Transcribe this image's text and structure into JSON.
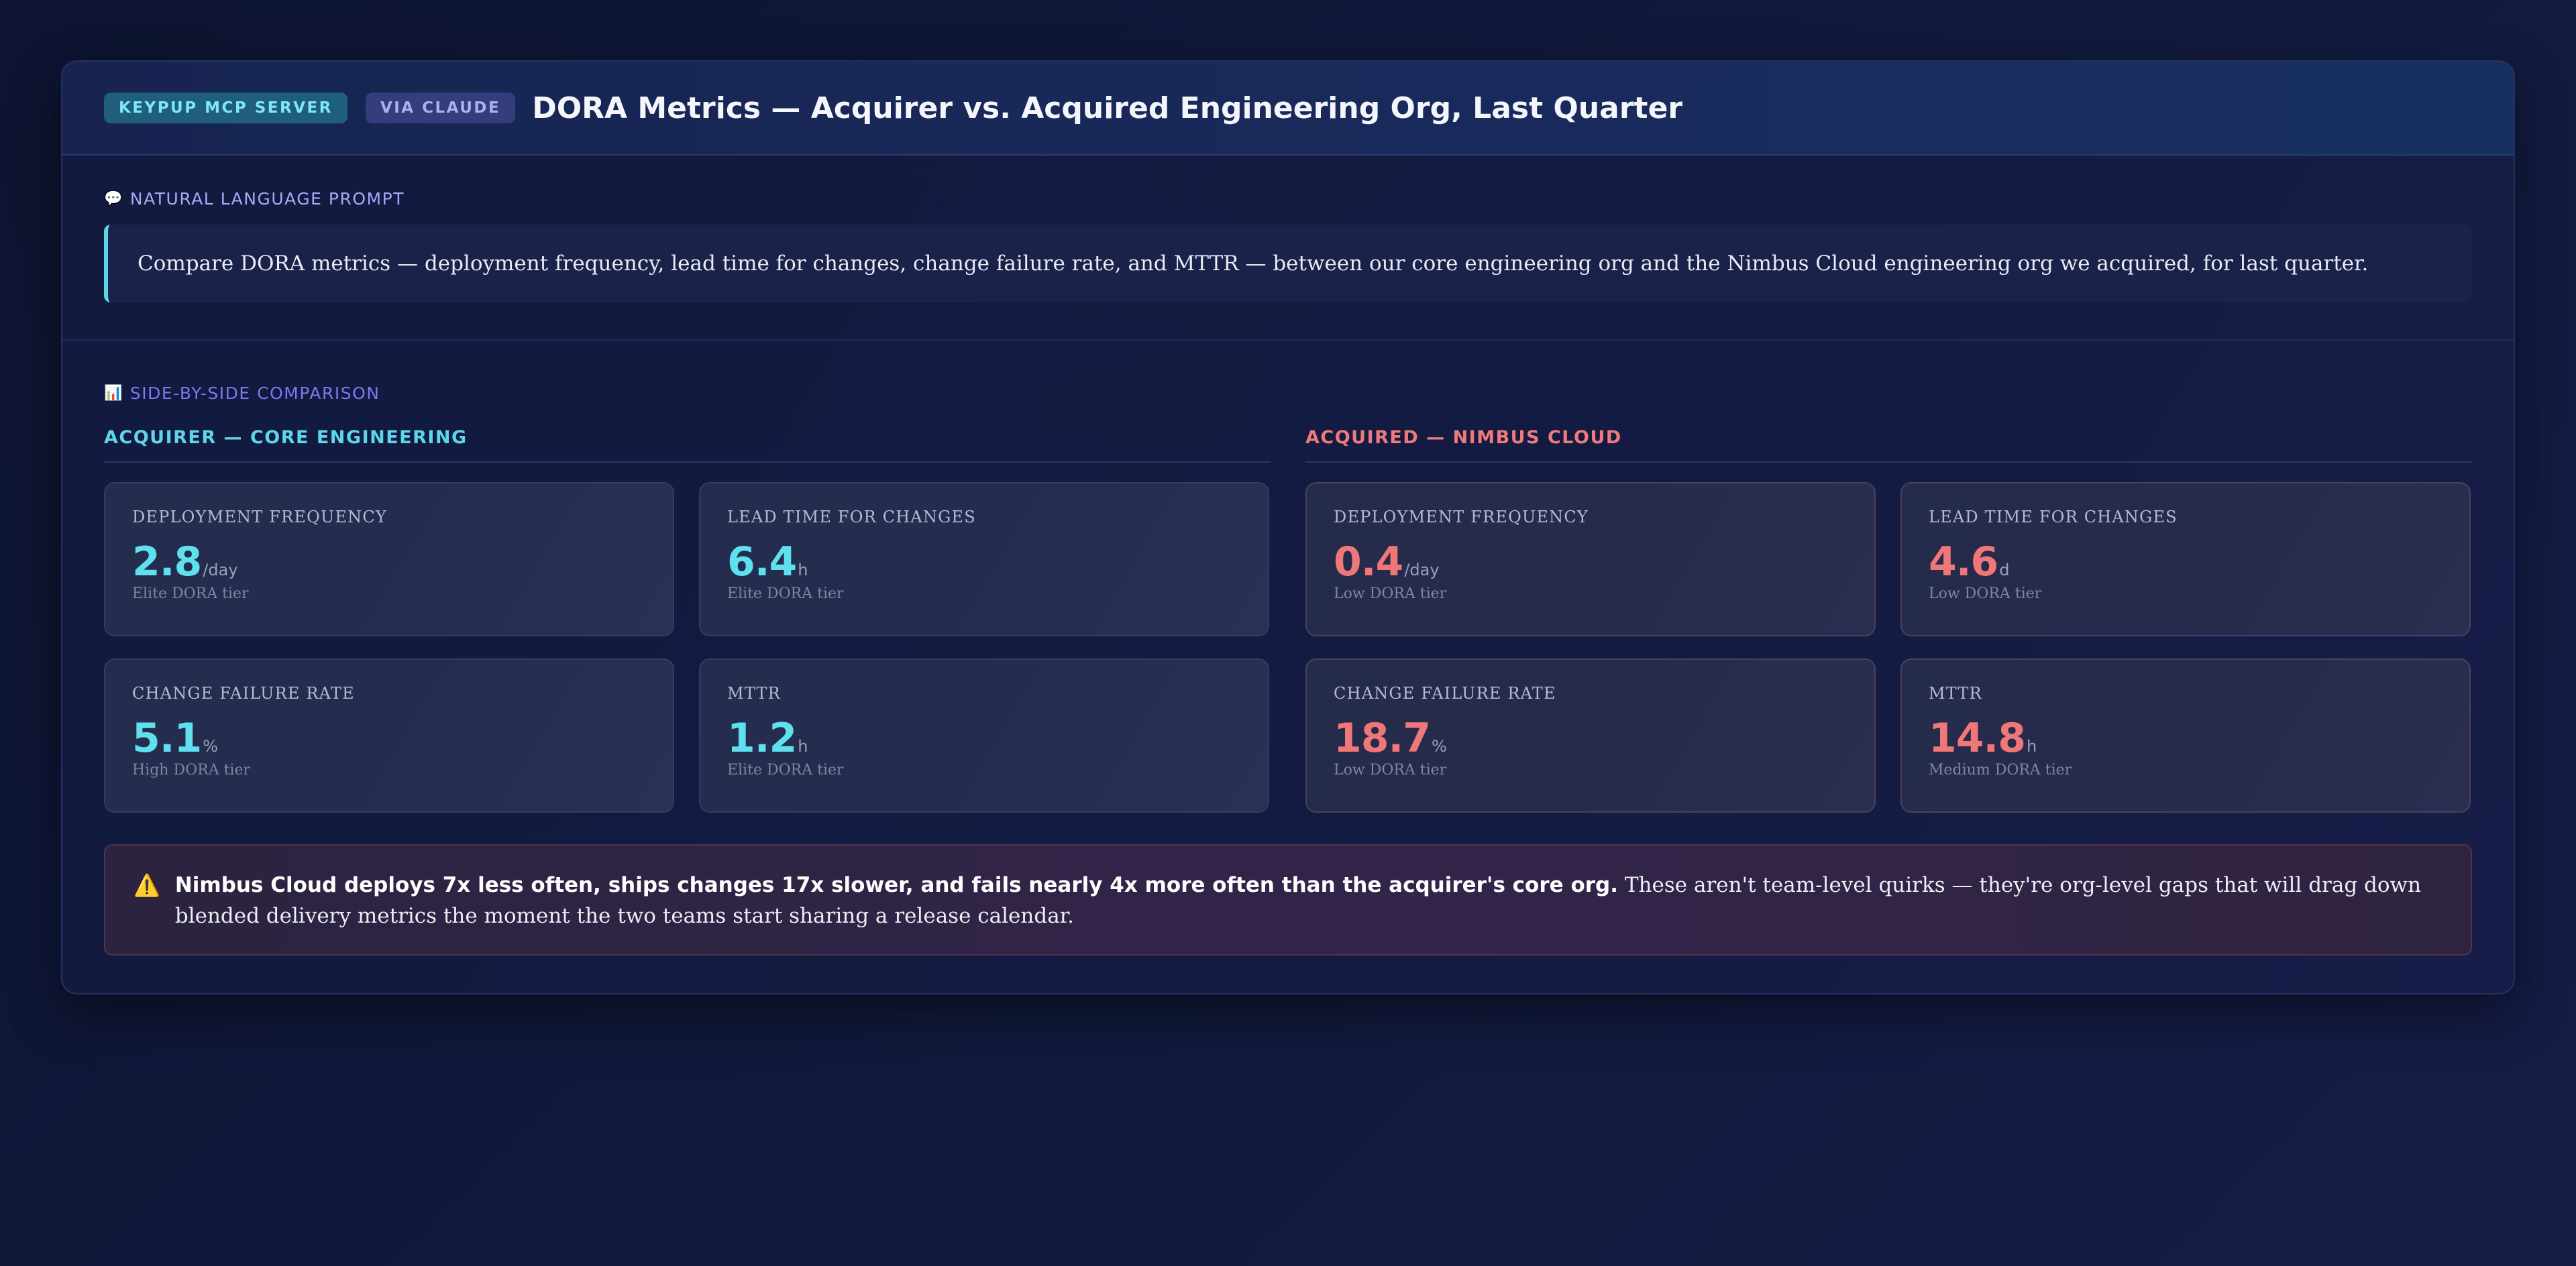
{
  "header": {
    "badge_server": "KEYPUP MCP SERVER",
    "badge_via": "VIA CLAUDE",
    "title": "DORA Metrics — Acquirer vs. Acquired Engineering Org, Last Quarter"
  },
  "prompt": {
    "label": "NATURAL LANGUAGE PROMPT",
    "icon": "speech-bubble-icon",
    "text": "Compare DORA metrics — deployment frequency, lead time for changes, change failure rate, and MTTR — between our core engineering org and the Nimbus Cloud engineering org we acquired, for last quarter."
  },
  "comparison": {
    "label": "SIDE-BY-SIDE COMPARISON",
    "icon": "bar-chart-icon",
    "acquirer": {
      "title": "ACQUIRER — CORE ENGINEERING",
      "accent": "#5fe0ef",
      "metrics": [
        {
          "label": "DEPLOYMENT FREQUENCY",
          "value": "2.8",
          "unit": "/day",
          "tier": "Elite DORA tier"
        },
        {
          "label": "LEAD TIME FOR CHANGES",
          "value": "6.4",
          "unit": "h",
          "tier": "Elite DORA tier"
        },
        {
          "label": "CHANGE FAILURE RATE",
          "value": "5.1",
          "unit": "%",
          "tier": "High DORA tier"
        },
        {
          "label": "MTTR",
          "value": "1.2",
          "unit": "h",
          "tier": "Elite DORA tier"
        }
      ]
    },
    "acquired": {
      "title": "ACQUIRED — NIMBUS CLOUD",
      "accent": "#f07777",
      "metrics": [
        {
          "label": "DEPLOYMENT FREQUENCY",
          "value": "0.4",
          "unit": "/day",
          "tier": "Low DORA tier"
        },
        {
          "label": "LEAD TIME FOR CHANGES",
          "value": "4.6",
          "unit": "d",
          "tier": "Low DORA tier"
        },
        {
          "label": "CHANGE FAILURE RATE",
          "value": "18.7",
          "unit": "%",
          "tier": "Low DORA tier"
        },
        {
          "label": "MTTR",
          "value": "14.8",
          "unit": "h",
          "tier": "Medium DORA tier"
        }
      ]
    }
  },
  "warning": {
    "icon": "warning-icon",
    "bold": "Nimbus Cloud deploys 7x less often, ships changes 17x slower, and fails nearly 4x more often than the acquirer's core org.",
    "text": " These aren't team-level quirks — they're org-level gaps that will drag down blended delivery metrics the moment the two teams start sharing a release calendar."
  }
}
